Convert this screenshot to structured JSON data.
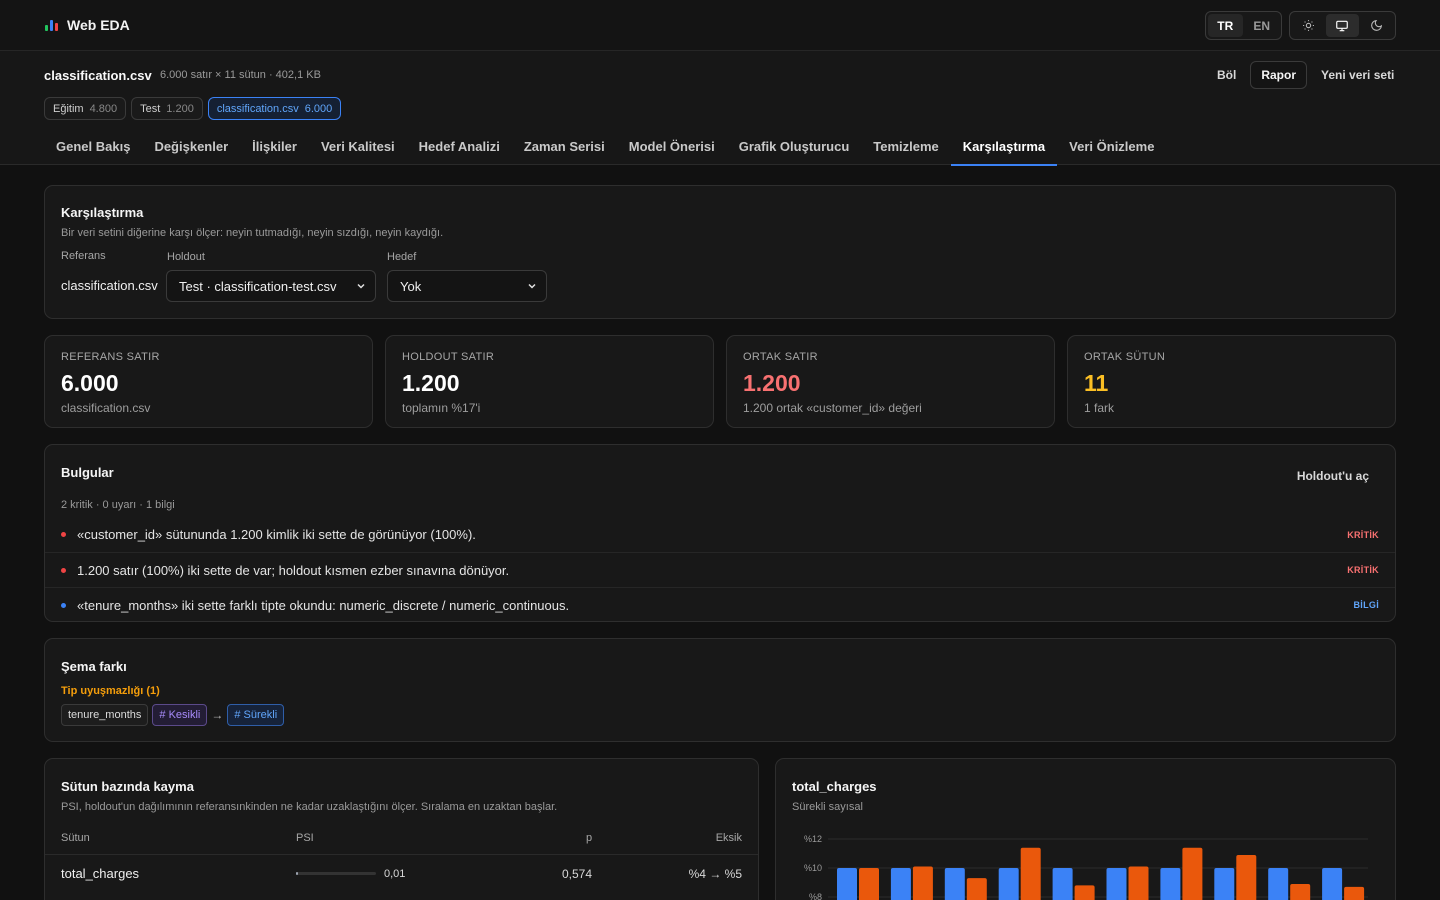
{
  "app": {
    "title": "Web EDA"
  },
  "brand_colors": [
    "#22c55e",
    "#3b82f6",
    "#ef4444"
  ],
  "language": {
    "options": [
      "TR",
      "EN"
    ],
    "selected": "TR"
  },
  "theme": {
    "options": [
      "sun-icon",
      "monitor-icon",
      "moon-icon"
    ],
    "selected": "monitor-icon"
  },
  "dataset": {
    "name": "classification.csv",
    "meta": "6.000 satır × 11 sütun · 402,1 KB",
    "actions": {
      "split": "Böl",
      "report": "Rapor",
      "new": "Yeni veri seti"
    },
    "chips": [
      {
        "label": "Eğitim",
        "count": "4.800",
        "active": false
      },
      {
        "label": "Test",
        "count": "1.200",
        "active": false
      },
      {
        "label": "classification.csv",
        "count": "6.000",
        "active": true
      }
    ]
  },
  "tabs": [
    "Genel Bakış",
    "Değişkenler",
    "İlişkiler",
    "Veri Kalitesi",
    "Hedef Analizi",
    "Zaman Serisi",
    "Model Önerisi",
    "Grafik Oluşturucu",
    "Temizleme",
    "Karşılaştırma",
    "Veri Önizleme"
  ],
  "active_tab": "Karşılaştırma",
  "comparison": {
    "title": "Karşılaştırma",
    "description": "Bir veri setini diğerine karşı ölçer: neyin tutmadığı, neyin sızdığı, neyin kaydığı.",
    "reference_label": "Referans",
    "reference_value": "classification.csv",
    "holdout_label": "Holdout",
    "holdout_value": "Test · classification-test.csv",
    "target_label": "Hedef",
    "target_value": "Yok"
  },
  "stats": [
    {
      "label": "REFERANS SATIR",
      "value": "6.000",
      "sub": "classification.csv",
      "color": "#ffffff"
    },
    {
      "label": "HOLDOUT SATIR",
      "value": "1.200",
      "sub": "toplamın %17'i",
      "color": "#ffffff"
    },
    {
      "label": "ORTAK SATIR",
      "value": "1.200",
      "sub": "1.200 ortak «customer_id» değeri",
      "color": "#f87171"
    },
    {
      "label": "ORTAK SÜTUN",
      "value": "11",
      "sub": "1 fark",
      "color": "#fbbf24"
    }
  ],
  "findings": {
    "title": "Bulgular",
    "open_holdout": "Holdout'u aç",
    "summary": "2 kritik · 0 uyarı · 1 bilgi",
    "items": [
      {
        "text": "«customer_id» sütununda 1.200 kimlik iki sette de görünüyor (100%).",
        "severity": "KRİTİK",
        "color": "#ef4444",
        "badge_color": "#f87171"
      },
      {
        "text": "1.200 satır (100%) iki sette de var; holdout kısmen ezber sınavına dönüyor.",
        "severity": "KRİTİK",
        "color": "#ef4444",
        "badge_color": "#f87171"
      },
      {
        "text": "«tenure_months» iki sette farklı tipte okundu: numeric_discrete / numeric_continuous.",
        "severity": "BİLGİ",
        "color": "#3b82f6",
        "badge_color": "#60a5fa"
      }
    ]
  },
  "schema": {
    "title": "Şema farkı",
    "subtitle": "Tip uyuşmazlığı (1)",
    "column": "tenure_months",
    "from_type": "# Kesikli",
    "arrow": "→",
    "to_type": "# Sürekli"
  },
  "drift": {
    "title": "Sütun bazında kayma",
    "description": "PSI, holdout'un dağılımının referansınkinden ne kadar uzaklaştığını ölçer. Sıralama en uzaktan başlar.",
    "headers": {
      "column": "Sütun",
      "psi": "PSI",
      "p": "p",
      "missing": "Eksik"
    },
    "rows": [
      {
        "column": "total_charges",
        "psi": "0,01",
        "psi_fraction": 0.01,
        "p": "0,574",
        "missing": "%4 → %5"
      }
    ]
  },
  "chart_card": {
    "title": "total_charges",
    "subtitle": "Sürekli sayısal"
  },
  "chart_data": {
    "type": "bar",
    "ylim": [
      0,
      0.13
    ],
    "y_ticks": [
      {
        "value": 0.12,
        "label": "%12"
      },
      {
        "value": 0.1,
        "label": "%10"
      },
      {
        "value": 0.08,
        "label": "%8"
      }
    ],
    "grid": true,
    "series": [
      {
        "color": "#3b82f6",
        "values": [
          0.1,
          0.1,
          0.1,
          0.1,
          0.1,
          0.1,
          0.1,
          0.1,
          0.1,
          0.1
        ]
      },
      {
        "color": "#ea580c",
        "values": [
          0.1,
          0.101,
          0.093,
          0.114,
          0.088,
          0.101,
          0.114,
          0.109,
          0.089,
          0.087
        ]
      }
    ]
  }
}
